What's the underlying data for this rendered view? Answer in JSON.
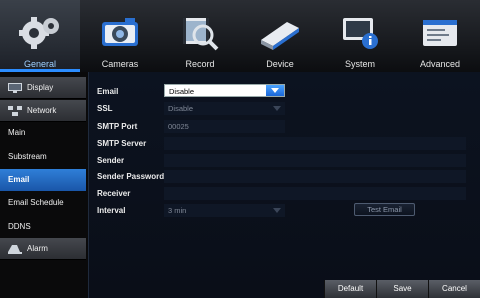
{
  "tabs": [
    {
      "label": "General",
      "icon": "gear-icon",
      "active": true
    },
    {
      "label": "Cameras",
      "icon": "camera-icon",
      "active": false
    },
    {
      "label": "Record",
      "icon": "film-magnifier-icon",
      "active": false
    },
    {
      "label": "Device",
      "icon": "hard-drive-icon",
      "active": false
    },
    {
      "label": "System",
      "icon": "monitor-info-icon",
      "active": false
    },
    {
      "label": "Advanced",
      "icon": "advanced-settings-icon",
      "active": false
    }
  ],
  "sidebar": {
    "items": [
      {
        "label": "Display",
        "group": true
      },
      {
        "label": "Network",
        "group": true
      },
      {
        "label": "Main",
        "group": false
      },
      {
        "label": "Substream",
        "group": false
      },
      {
        "label": "Email",
        "group": false,
        "active": true
      },
      {
        "label": "Email Schedule",
        "group": false
      },
      {
        "label": "DDNS",
        "group": false
      },
      {
        "label": "Alarm",
        "group": true
      }
    ]
  },
  "form": {
    "email_label": "Email",
    "email_value": "Disable",
    "ssl_label": "SSL",
    "ssl_value": "Disable",
    "smtp_port_label": "SMTP Port",
    "smtp_port_value": "00025",
    "smtp_server_label": "SMTP Server",
    "smtp_server_value": "",
    "sender_label": "Sender",
    "sender_value": "",
    "sender_password_label": "Sender Password",
    "sender_password_value": "",
    "receiver_label": "Receiver",
    "receiver_value": "",
    "interval_label": "Interval",
    "interval_value": "3 min",
    "test_email_label": "Test Email"
  },
  "buttons": {
    "default": "Default",
    "save": "Save",
    "cancel": "Cancel"
  },
  "colors": {
    "accent": "#2c8dff",
    "sidebar_active": "#1f63b8"
  }
}
